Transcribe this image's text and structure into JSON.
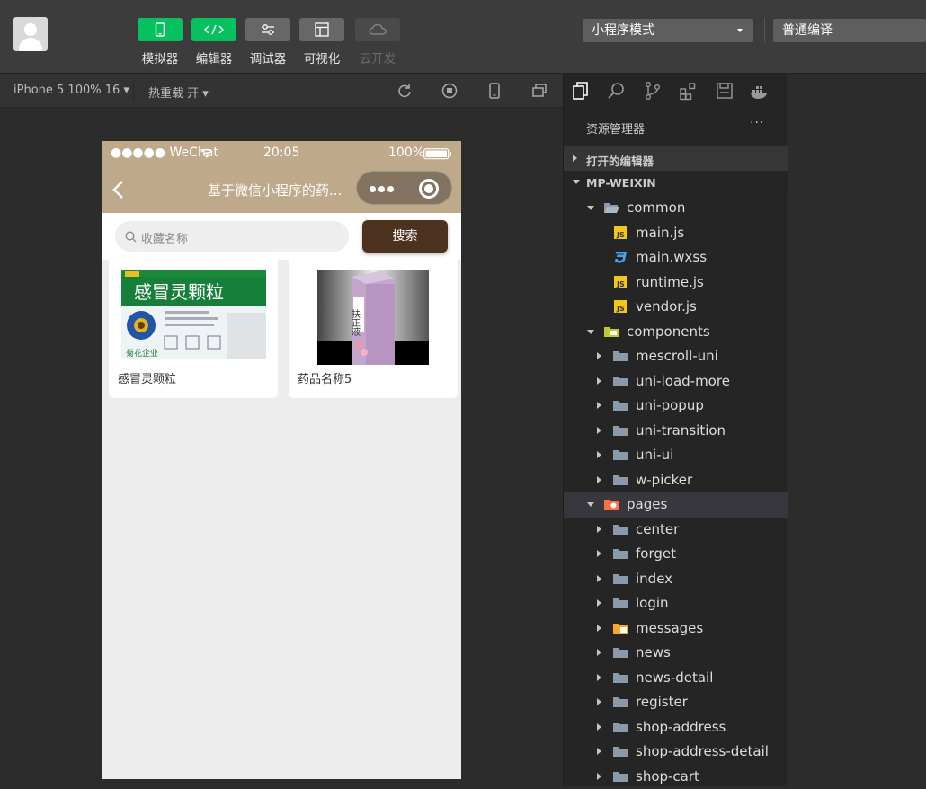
{
  "toolbar": {
    "tools": [
      {
        "label": "模拟器",
        "icon": "phone-icon",
        "style": "green"
      },
      {
        "label": "编辑器",
        "icon": "code-icon",
        "style": "green"
      },
      {
        "label": "调试器",
        "icon": "sliders-icon",
        "style": "gray"
      },
      {
        "label": "可视化",
        "icon": "layout-icon",
        "style": "gray"
      },
      {
        "label": "云开发",
        "icon": "cloud-icon",
        "style": "dim"
      }
    ],
    "mode_select": "小程序模式",
    "compile_select": "普通编译"
  },
  "simbar": {
    "device": "iPhone 5 100% 16",
    "hot_reload": "热重载 开"
  },
  "phone": {
    "status": {
      "carrier": "●●●●● WeChat",
      "time": "20:05",
      "battery": "100%"
    },
    "nav_title": "基于微信小程序的药...",
    "search_placeholder": "收藏名称",
    "search_button": "搜索",
    "products": [
      {
        "name": "感冒灵颗粒",
        "box_title": "感冒灵颗粒"
      },
      {
        "name": "药品名称5",
        "box_title": "扶正液"
      }
    ]
  },
  "explorer": {
    "title": "资源管理器",
    "more": "···",
    "open_editors": "打开的编辑器",
    "project": "MP-WEIXIN",
    "tree": [
      {
        "label": "common",
        "depth": 1,
        "type": "folder-open",
        "arrow": "down"
      },
      {
        "label": "main.js",
        "depth": 2,
        "type": "js"
      },
      {
        "label": "main.wxss",
        "depth": 2,
        "type": "css"
      },
      {
        "label": "runtime.js",
        "depth": 2,
        "type": "js"
      },
      {
        "label": "vendor.js",
        "depth": 2,
        "type": "js"
      },
      {
        "label": "components",
        "depth": 1,
        "type": "folder-components",
        "arrow": "down"
      },
      {
        "label": "mescroll-uni",
        "depth": 2,
        "type": "folder",
        "arrow": "right"
      },
      {
        "label": "uni-load-more",
        "depth": 2,
        "type": "folder",
        "arrow": "right"
      },
      {
        "label": "uni-popup",
        "depth": 2,
        "type": "folder",
        "arrow": "right"
      },
      {
        "label": "uni-transition",
        "depth": 2,
        "type": "folder",
        "arrow": "right"
      },
      {
        "label": "uni-ui",
        "depth": 2,
        "type": "folder",
        "arrow": "right"
      },
      {
        "label": "w-picker",
        "depth": 2,
        "type": "folder",
        "arrow": "right"
      },
      {
        "label": "pages",
        "depth": 1,
        "type": "folder-pages",
        "arrow": "down",
        "selected": true
      },
      {
        "label": "center",
        "depth": 2,
        "type": "folder",
        "arrow": "right"
      },
      {
        "label": "forget",
        "depth": 2,
        "type": "folder",
        "arrow": "right"
      },
      {
        "label": "index",
        "depth": 2,
        "type": "folder",
        "arrow": "right"
      },
      {
        "label": "login",
        "depth": 2,
        "type": "folder",
        "arrow": "right"
      },
      {
        "label": "messages",
        "depth": 2,
        "type": "folder-messages",
        "arrow": "right"
      },
      {
        "label": "news",
        "depth": 2,
        "type": "folder",
        "arrow": "right"
      },
      {
        "label": "news-detail",
        "depth": 2,
        "type": "folder",
        "arrow": "right"
      },
      {
        "label": "register",
        "depth": 2,
        "type": "folder",
        "arrow": "right"
      },
      {
        "label": "shop-address",
        "depth": 2,
        "type": "folder",
        "arrow": "right"
      },
      {
        "label": "shop-address-detail",
        "depth": 2,
        "type": "folder",
        "arrow": "right"
      },
      {
        "label": "shop-cart",
        "depth": 2,
        "type": "folder",
        "arrow": "right"
      }
    ]
  },
  "colors": {
    "accent_green": "#07c160",
    "nav_bg": "#bfa98b",
    "search_button_bg": "#4e3220"
  }
}
